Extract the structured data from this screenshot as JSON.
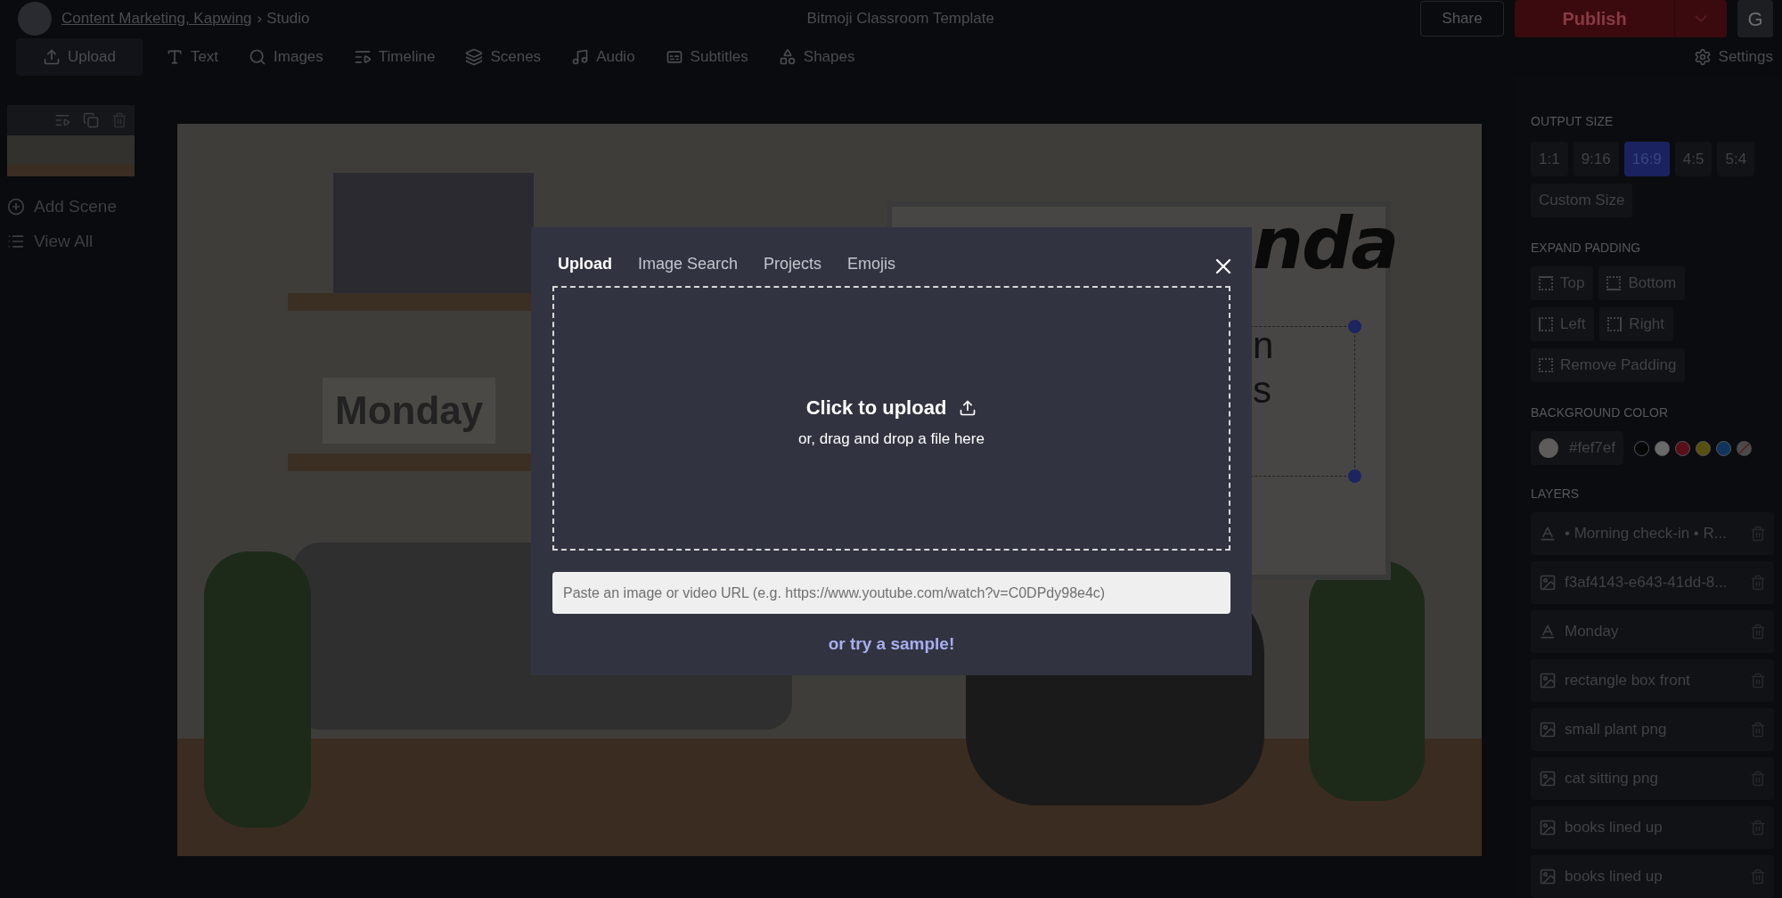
{
  "header": {
    "breadcrumb_link": "Content Marketing, Kapwing",
    "separator": "›",
    "breadcrumb_current": "Studio",
    "title": "Bitmoji Classroom Template",
    "share": "Share",
    "publish": "Publish",
    "avatar_letter": "G"
  },
  "toolbar": {
    "items": [
      {
        "label": "Upload",
        "selected": true
      },
      {
        "label": "Text",
        "selected": false
      },
      {
        "label": "Images",
        "selected": false
      },
      {
        "label": "Timeline",
        "selected": false
      },
      {
        "label": "Scenes",
        "selected": false
      },
      {
        "label": "Audio",
        "selected": false
      },
      {
        "label": "Subtitles",
        "selected": false
      },
      {
        "label": "Shapes",
        "selected": false
      }
    ],
    "settings": "Settings"
  },
  "scenes": {
    "add_scene": "Add Scene",
    "view_all": "View All"
  },
  "canvas": {
    "texts": [
      {
        "kind": "label",
        "text": "Monday"
      },
      {
        "kind": "title",
        "text": "nda"
      },
      {
        "kind": "line",
        "text": "n"
      },
      {
        "kind": "line",
        "text": "s"
      }
    ]
  },
  "modal": {
    "tabs": [
      {
        "label": "Upload",
        "selected": true
      },
      {
        "label": "Image Search",
        "selected": false
      },
      {
        "label": "Projects",
        "selected": false
      },
      {
        "label": "Emojis",
        "selected": false
      }
    ],
    "drop_title": "Click to upload",
    "drop_hint": "or, drag and drop a file here",
    "url_field": {
      "placeholder": "Paste an image or video URL (e.g. https://www.youtube.com/watch?v=C0DPdy98e4c)"
    },
    "sample_link": "or try a sample!"
  },
  "panel": {
    "output_size": {
      "label": "OUTPUT SIZE",
      "options": [
        {
          "label": "1:1",
          "selected": false
        },
        {
          "label": "9:16",
          "selected": false
        },
        {
          "label": "16:9",
          "selected": true
        },
        {
          "label": "4:5",
          "selected": false
        },
        {
          "label": "5:4",
          "selected": false
        }
      ],
      "custom": "Custom Size"
    },
    "padding": {
      "label": "EXPAND PADDING",
      "options": [
        {
          "label": "Top"
        },
        {
          "label": "Bottom"
        },
        {
          "label": "Left"
        },
        {
          "label": "Right"
        },
        {
          "label": "Remove Padding"
        }
      ]
    },
    "background": {
      "label": "BACKGROUND COLOR",
      "value": "#fef7ef",
      "swatches": [
        {
          "kind": "solid",
          "color": "#050505"
        },
        {
          "kind": "solid",
          "color": "#6a6a6a"
        },
        {
          "kind": "solid",
          "color": "#5a0f18"
        },
        {
          "kind": "solid",
          "color": "#58500f"
        },
        {
          "kind": "solid",
          "color": "#10345e"
        },
        {
          "kind": "none"
        }
      ]
    },
    "layers": {
      "label": "LAYERS",
      "items": [
        {
          "kind": "text",
          "name": "• Morning check-in • R..."
        },
        {
          "kind": "image",
          "name": "f3af4143-e643-41dd-8..."
        },
        {
          "kind": "text",
          "name": "Monday"
        },
        {
          "kind": "image",
          "name": "rectangle box front"
        },
        {
          "kind": "image",
          "name": "small plant png"
        },
        {
          "kind": "image",
          "name": "cat sitting png"
        },
        {
          "kind": "image",
          "name": "books lined up"
        },
        {
          "kind": "image",
          "name": "books lined up"
        }
      ]
    }
  }
}
